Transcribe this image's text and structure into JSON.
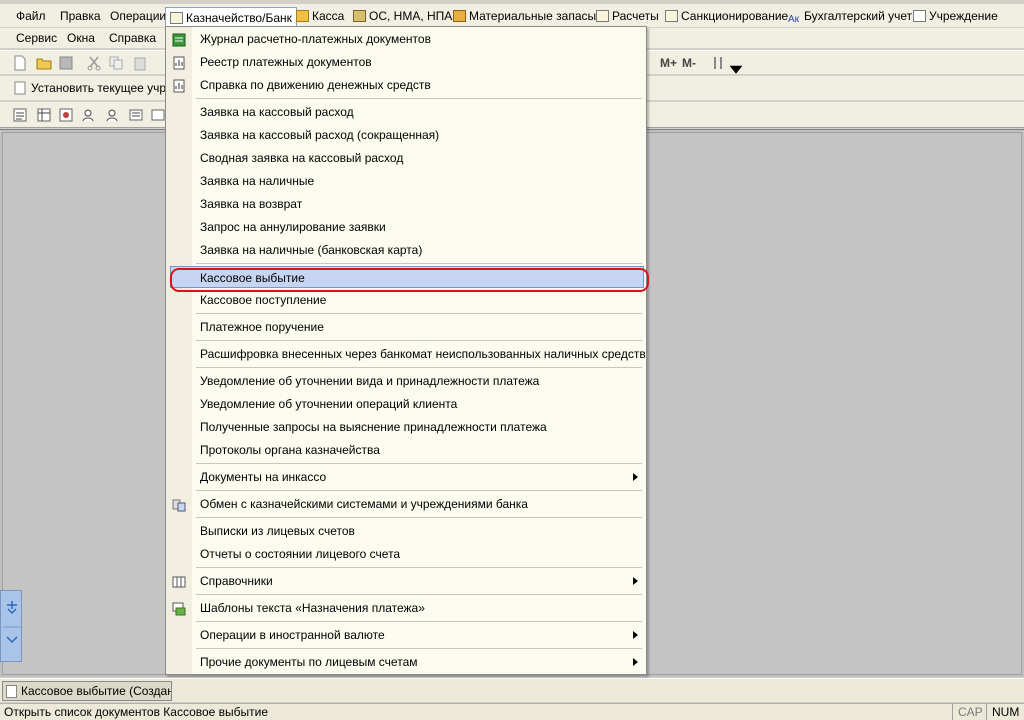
{
  "menubar": {
    "items": [
      {
        "label": "Файл"
      },
      {
        "label": "Правка"
      },
      {
        "label": "Операции"
      },
      {
        "label": "Казначейство/Банк"
      },
      {
        "label": "Касса"
      },
      {
        "label": "ОС, НМА, НПА"
      },
      {
        "label": "Материальные запасы"
      },
      {
        "label": "Расчеты"
      },
      {
        "label": "Санкционирование"
      },
      {
        "label": "Бухгалтерский учет"
      },
      {
        "label": "Учреждение"
      }
    ]
  },
  "menubar2": {
    "items": [
      {
        "label": "Сервис"
      },
      {
        "label": "Окна"
      },
      {
        "label": "Справка"
      }
    ]
  },
  "toolbar": {
    "mplus": "M+",
    "mminus": "M-",
    "set_current_label": "Установить текущее учреждение"
  },
  "dropdown": {
    "items": [
      {
        "label": "Журнал  расчетно-платежных документов"
      },
      {
        "label": "Реестр платежных документов"
      },
      {
        "label": "Справка по движению денежных средств"
      },
      {
        "label": "Заявка на кассовый расход"
      },
      {
        "label": "Заявка на кассовый расход (сокращенная)"
      },
      {
        "label": "Сводная заявка на кассовый расход"
      },
      {
        "label": "Заявка на наличные"
      },
      {
        "label": "Заявка на возврат"
      },
      {
        "label": "Запрос на аннулирование заявки"
      },
      {
        "label": "Заявка на наличные (банковская карта)"
      },
      {
        "label": "Кассовое выбытие"
      },
      {
        "label": "Кассовое поступление"
      },
      {
        "label": "Платежное поручение"
      },
      {
        "label": "Расшифровка внесенных через банкомат неиспользованных наличных средств"
      },
      {
        "label": "Уведомление об уточнении вида и принадлежности платежа"
      },
      {
        "label": "Уведомление об уточнении операций клиента"
      },
      {
        "label": "Полученные запросы на выяснение принадлежности платежа"
      },
      {
        "label": "Протоколы органа казначейства"
      },
      {
        "label": "Документы на инкассо"
      },
      {
        "label": "Обмен с казначейскими системами и учреждениями банка"
      },
      {
        "label": "Выписки из лицевых счетов"
      },
      {
        "label": "Отчеты о состоянии лицевого счета"
      },
      {
        "label": "Справочники"
      },
      {
        "label": "Шаблоны текста «Назначения платежа»"
      },
      {
        "label": "Операции в иностранной валюте"
      },
      {
        "label": "Прочие документы по лицевым счетам"
      }
    ]
  },
  "taskbar": {
    "window_label": "Кассовое выбытие (Создан..."
  },
  "statusbar": {
    "text": "Открыть список документов Кассовое выбытие",
    "cap": "CAP",
    "num": "NUM"
  },
  "colors": {
    "highlight": "#c6d6f2",
    "annotation": "#d8121a"
  }
}
